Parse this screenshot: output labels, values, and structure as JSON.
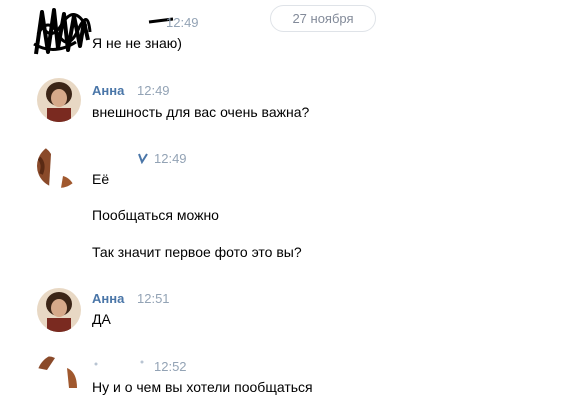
{
  "date_divider": "27 ноября",
  "messages": [
    {
      "author": "",
      "time": "12:49",
      "lines": [
        "Я не не знаю)"
      ]
    },
    {
      "author": "Анна",
      "time": "12:49",
      "lines": [
        "внешность для вас очень важна?"
      ]
    },
    {
      "author": "",
      "time": "12:49",
      "lines": [
        "Её",
        "Пообщаться можно",
        "Так значит первое фото это вы?"
      ]
    },
    {
      "author": "Анна",
      "time": "12:51",
      "lines": [
        "ДА"
      ]
    },
    {
      "author": "",
      "time": "12:52",
      "lines": [
        "Ну и о чем вы хотели пообщаться"
      ]
    }
  ],
  "colors": {
    "author_link": "#4a76a8",
    "time": "#93a3b5",
    "date_pill_text": "#828a99"
  },
  "icons": [
    "avatar-photo",
    "redaction-scribble"
  ]
}
